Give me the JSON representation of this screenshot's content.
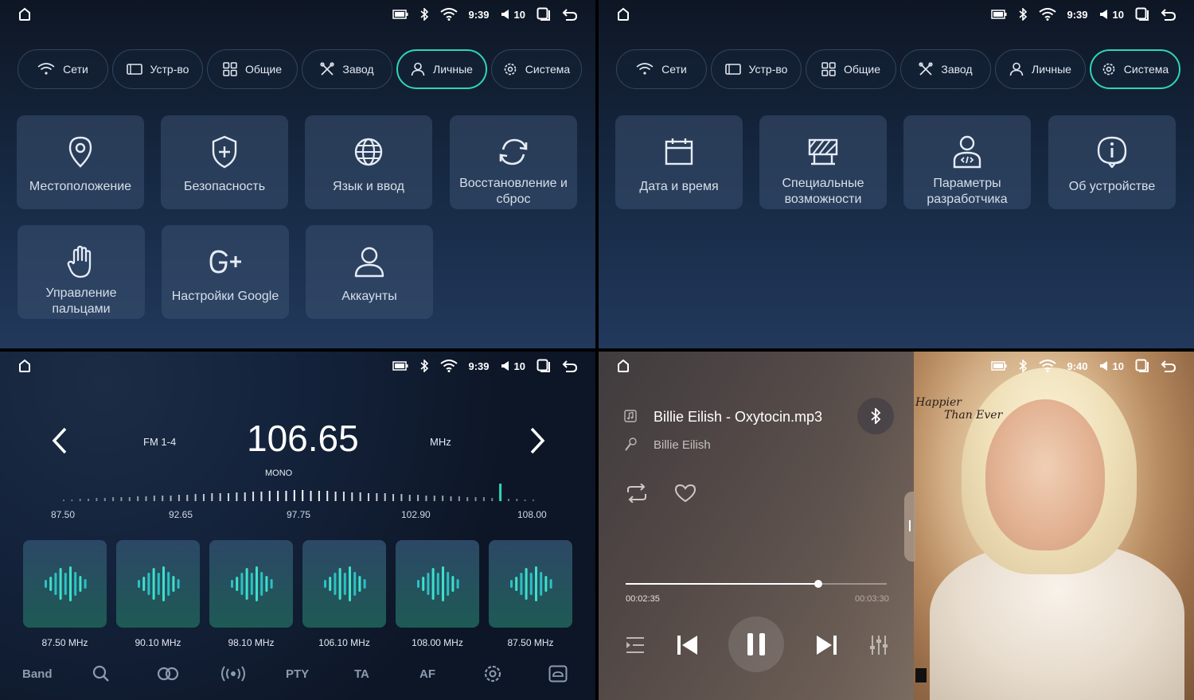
{
  "settings_personal": {
    "status": {
      "time": "9:39",
      "volume": "10"
    },
    "tabs": [
      {
        "label": "Сети",
        "icon": "wifi-icon"
      },
      {
        "label": "Устр-во",
        "icon": "device-icon"
      },
      {
        "label": "Общие",
        "icon": "grid-icon"
      },
      {
        "label": "Завод",
        "icon": "tools-icon"
      },
      {
        "label": "Личные",
        "icon": "person-icon",
        "active": true
      },
      {
        "label": "Система",
        "icon": "gear-icon"
      }
    ],
    "tiles": [
      {
        "label": "Местоположение",
        "icon": "location-pin-icon"
      },
      {
        "label": "Безопасность",
        "icon": "shield-icon"
      },
      {
        "label": "Язык и ввод",
        "icon": "globe-icon"
      },
      {
        "label": "Восстановление и сброс",
        "icon": "refresh-icon"
      },
      {
        "label": "Управление пальцами",
        "icon": "hand-icon"
      },
      {
        "label": "Настройки Google",
        "icon": "google-plus-icon"
      },
      {
        "label": "Аккаунты",
        "icon": "account-icon"
      }
    ]
  },
  "settings_system": {
    "status": {
      "time": "9:39",
      "volume": "10"
    },
    "tabs": [
      {
        "label": "Сети",
        "icon": "wifi-icon"
      },
      {
        "label": "Устр-во",
        "icon": "device-icon"
      },
      {
        "label": "Общие",
        "icon": "grid-icon"
      },
      {
        "label": "Завод",
        "icon": "tools-icon"
      },
      {
        "label": "Личные",
        "icon": "person-icon"
      },
      {
        "label": "Система",
        "icon": "gear-icon",
        "active": true
      }
    ],
    "tiles": [
      {
        "label": "Дата и время",
        "icon": "calendar-icon"
      },
      {
        "label": "Специальные возможности",
        "icon": "accessibility-icon"
      },
      {
        "label": "Параметры разработчика",
        "icon": "developer-icon"
      },
      {
        "label": "Об устройстве",
        "icon": "info-icon"
      }
    ]
  },
  "radio": {
    "status": {
      "time": "9:39",
      "volume": "10"
    },
    "band": "FM 1-4",
    "frequency": "106.65",
    "unit": "MHz",
    "mode": "MONO",
    "scale": {
      "min": 87.5,
      "max": 108.0,
      "current": 106.65,
      "labels": [
        "87.50",
        "92.65",
        "97.75",
        "102.90",
        "108.00"
      ]
    },
    "presets": [
      "87.50 MHz",
      "90.10 MHz",
      "98.10 MHz",
      "106.10 MHz",
      "108.00 MHz",
      "87.50 MHz"
    ],
    "bottom": {
      "band_label": "Band",
      "pty_label": "PTY",
      "ta_label": "TA",
      "af_label": "AF"
    },
    "accent": "#2fd6b8"
  },
  "music": {
    "status": {
      "time": "9:40",
      "volume": "10"
    },
    "song": "Billie Eilish - Oxytocin.mp3",
    "artist": "Billie Eilish",
    "current_time": "00:02:35",
    "total_time": "00:03:30",
    "progress": 0.738,
    "album_text_1": "Happier",
    "album_text_2": "Than Ever"
  }
}
